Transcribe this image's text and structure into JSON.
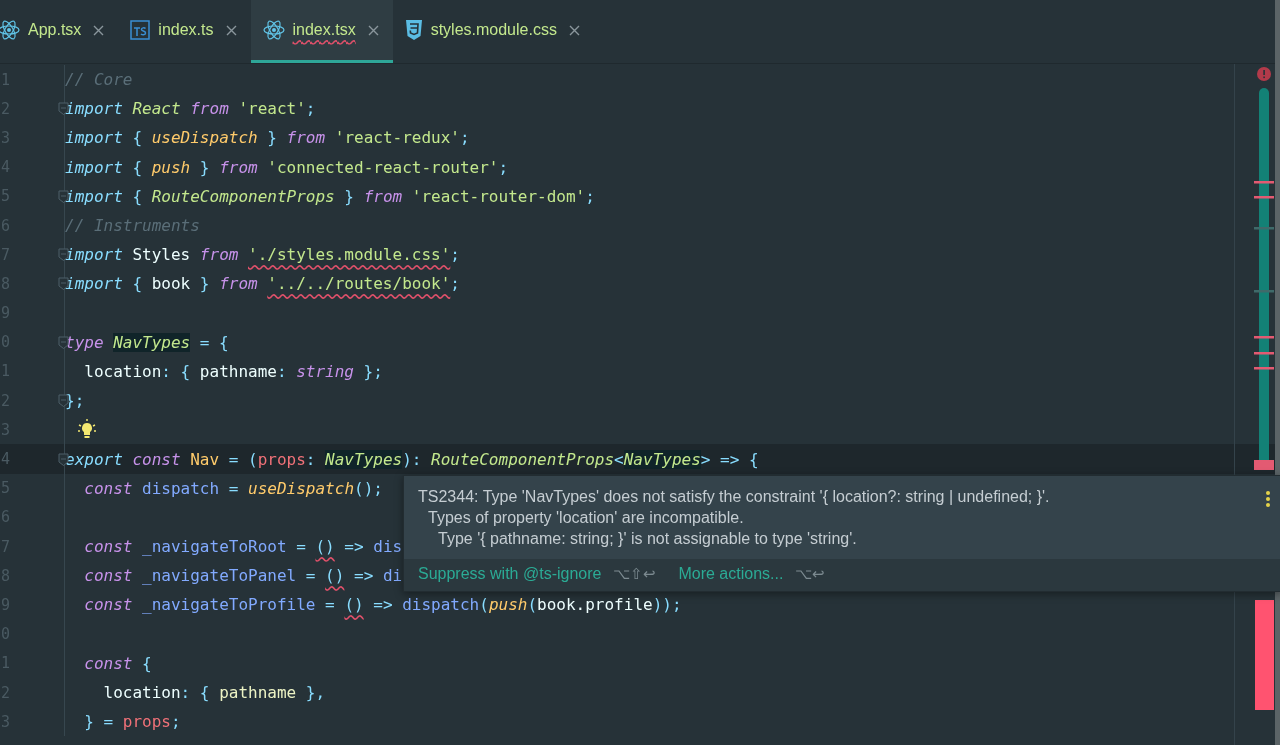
{
  "tabs": [
    {
      "label": "App.tsx",
      "kind": "react",
      "selected": false,
      "error": false
    },
    {
      "label": "index.ts",
      "kind": "ts",
      "selected": false,
      "error": false
    },
    {
      "label": "index.tsx",
      "kind": "react",
      "selected": true,
      "error": true
    },
    {
      "label": "styles.module.css",
      "kind": "css",
      "selected": false,
      "error": false
    }
  ],
  "editor": {
    "lines": [
      {
        "number": "1",
        "kind": "plain",
        "current": false,
        "tokens": [
          {
            "kind": "comment",
            "text": "// Core"
          }
        ]
      },
      {
        "number": "2",
        "kind": "fold",
        "current": false,
        "tokens": [
          {
            "kind": "imp",
            "text": "import"
          },
          {
            "kind": "type",
            "text": " React"
          },
          {
            "kind": "kw",
            "text": " from"
          },
          {
            "kind": "str",
            "text": " 'react'"
          },
          {
            "kind": "punct",
            "text": ";"
          }
        ]
      },
      {
        "number": "3",
        "kind": "plain",
        "current": false,
        "tokens": [
          {
            "kind": "imp",
            "text": "import"
          },
          {
            "kind": "punct",
            "text": " { "
          },
          {
            "kind": "fn",
            "text": "useDispatch"
          },
          {
            "kind": "punct",
            "text": " } "
          },
          {
            "kind": "kw",
            "text": "from"
          },
          {
            "kind": "str",
            "text": " 'react-redux'"
          },
          {
            "kind": "punct",
            "text": ";"
          }
        ]
      },
      {
        "number": "4",
        "kind": "plain",
        "current": false,
        "tokens": [
          {
            "kind": "imp",
            "text": "import"
          },
          {
            "kind": "punct",
            "text": " { "
          },
          {
            "kind": "fn",
            "text": "push"
          },
          {
            "kind": "punct",
            "text": " } "
          },
          {
            "kind": "kw",
            "text": "from"
          },
          {
            "kind": "str",
            "text": " 'connected-react-router'"
          },
          {
            "kind": "punct",
            "text": ";"
          }
        ]
      },
      {
        "number": "5",
        "kind": "fold",
        "current": false,
        "tokens": [
          {
            "kind": "imp",
            "text": "import"
          },
          {
            "kind": "punct",
            "text": " { "
          },
          {
            "kind": "type",
            "text": "RouteComponentProps"
          },
          {
            "kind": "punct",
            "text": " } "
          },
          {
            "kind": "kw",
            "text": "from"
          },
          {
            "kind": "str",
            "text": " 'react-router-dom'"
          },
          {
            "kind": "punct",
            "text": ";"
          }
        ]
      },
      {
        "number": "6",
        "kind": "plain",
        "current": false,
        "tokens": [
          {
            "kind": "comment",
            "text": "// Instruments"
          }
        ]
      },
      {
        "number": "7",
        "kind": "fold",
        "current": false,
        "tokens": [
          {
            "kind": "imp",
            "text": "import"
          },
          {
            "kind": "plain",
            "text": " Styles"
          },
          {
            "kind": "kw",
            "text": " from"
          },
          {
            "kind": "str-err",
            "text": "'./styles.module.css'",
            "gap": true
          },
          {
            "kind": "punct",
            "text": ";"
          }
        ]
      },
      {
        "number": "8",
        "kind": "fold",
        "current": false,
        "tokens": [
          {
            "kind": "imp",
            "text": "import"
          },
          {
            "kind": "punct",
            "text": " { "
          },
          {
            "kind": "plain",
            "text": "book"
          },
          {
            "kind": "punct",
            "text": " } "
          },
          {
            "kind": "kw",
            "text": "from"
          },
          {
            "kind": "str-err",
            "text": "'../../routes/book'",
            "gap": true
          },
          {
            "kind": "punct",
            "text": ";"
          }
        ]
      },
      {
        "number": "9",
        "kind": "plain",
        "current": false
      },
      {
        "number": "0",
        "kind": "fold",
        "current": false,
        "tokens": [
          {
            "kind": "kw",
            "text": "type"
          },
          {
            "kind": "type-hl",
            "text": "NavTypes",
            "gap": true
          },
          {
            "kind": "punct",
            "text": " = {"
          }
        ]
      },
      {
        "number": "1",
        "kind": "plain",
        "current": false,
        "tokens": [
          {
            "kind": "plain",
            "text": "  location"
          },
          {
            "kind": "punct",
            "text": ": { "
          },
          {
            "kind": "plain",
            "text": "pathname"
          },
          {
            "kind": "punct",
            "text": ": "
          },
          {
            "kind": "kw",
            "text": "string"
          },
          {
            "kind": "punct",
            "text": " };"
          }
        ]
      },
      {
        "number": "2",
        "kind": "fold",
        "current": false,
        "tokens": [
          {
            "kind": "punct",
            "text": "};"
          }
        ]
      },
      {
        "number": "3",
        "kind": "bulb",
        "current": false
      },
      {
        "number": "4",
        "kind": "fold",
        "current": true,
        "tokens": [
          {
            "kind": "imp",
            "text": "export"
          },
          {
            "kind": "kw",
            "text": " const"
          },
          {
            "kind": "name",
            "text": " Nav"
          },
          {
            "kind": "punct",
            "text": " = ("
          },
          {
            "kind": "param",
            "text": "props"
          },
          {
            "kind": "punct",
            "text": ": "
          },
          {
            "kind": "type-hl",
            "text": "NavTypes"
          },
          {
            "kind": "punct",
            "text": "): "
          },
          {
            "kind": "type",
            "text": "RouteComponentProps"
          },
          {
            "kind": "punct",
            "text": "<"
          },
          {
            "kind": "type-hl",
            "text": "NavTypes"
          },
          {
            "kind": "punct",
            "text": "> => {"
          }
        ]
      },
      {
        "number": "5",
        "kind": "plain",
        "current": false,
        "tokens": [
          {
            "kind": "kw",
            "text": "  const"
          },
          {
            "kind": "var",
            "text": " dispatch"
          },
          {
            "kind": "punct",
            "text": " = "
          },
          {
            "kind": "fn",
            "text": "useDispatch"
          },
          {
            "kind": "punct",
            "text": "();"
          }
        ]
      },
      {
        "number": "6",
        "kind": "plain",
        "current": false
      },
      {
        "number": "7",
        "kind": "plain",
        "current": false,
        "tokens": [
          {
            "kind": "kw",
            "text": "  const"
          },
          {
            "kind": "var",
            "text": " _navigateToRoot"
          },
          {
            "kind": "punct",
            "text": " = "
          },
          {
            "kind": "punct-err",
            "text": "()"
          },
          {
            "kind": "punct",
            "text": " => "
          },
          {
            "kind": "var",
            "text": "dis"
          }
        ]
      },
      {
        "number": "8",
        "kind": "plain",
        "current": false,
        "tokens": [
          {
            "kind": "kw",
            "text": "  const"
          },
          {
            "kind": "var",
            "text": " _navigateToPanel"
          },
          {
            "kind": "punct",
            "text": " = "
          },
          {
            "kind": "punct-err",
            "text": "()"
          },
          {
            "kind": "punct",
            "text": " => "
          },
          {
            "kind": "var",
            "text": "di"
          }
        ]
      },
      {
        "number": "9",
        "kind": "plain",
        "current": false,
        "tokens": [
          {
            "kind": "kw",
            "text": "  const"
          },
          {
            "kind": "var",
            "text": " _navigateToProfile"
          },
          {
            "kind": "punct",
            "text": " = "
          },
          {
            "kind": "punct-err",
            "text": "()"
          },
          {
            "kind": "punct",
            "text": " => "
          },
          {
            "kind": "var",
            "text": "dispatch"
          },
          {
            "kind": "punct",
            "text": "("
          },
          {
            "kind": "fn",
            "text": "push"
          },
          {
            "kind": "punct",
            "text": "("
          },
          {
            "kind": "plain",
            "text": "book.profile"
          },
          {
            "kind": "punct",
            "text": "));"
          }
        ]
      },
      {
        "number": "0",
        "kind": "plain",
        "current": false
      },
      {
        "number": "1",
        "kind": "plain",
        "current": false,
        "tokens": [
          {
            "kind": "kw",
            "text": "  const"
          },
          {
            "kind": "punct",
            "text": " {"
          }
        ]
      },
      {
        "number": "2",
        "kind": "plain",
        "current": false,
        "tokens": [
          {
            "kind": "plain",
            "text": "    location"
          },
          {
            "kind": "punct",
            "text": ": { "
          },
          {
            "kind": "prop",
            "text": "pathname"
          },
          {
            "kind": "punct",
            "text": " },"
          }
        ]
      },
      {
        "number": "3",
        "kind": "plain",
        "current": false,
        "tokens": [
          {
            "kind": "punct",
            "text": "  } = "
          },
          {
            "kind": "param",
            "text": "props"
          },
          {
            "kind": "punct",
            "text": ";"
          }
        ]
      }
    ]
  },
  "popup": {
    "message": [
      "TS2344: Type 'NavTypes' does not satisfy the constraint '{ location?: string | undefined; }'.",
      "Types of property 'location' are incompatible.",
      "Type '{ pathname: string; }' is not assignable to type 'string'."
    ],
    "actions": [
      {
        "label": "Suppress with @ts-ignore",
        "shortcut": "⌥⇧↩"
      },
      {
        "label": "More actions...",
        "shortcut": "⌥↩"
      }
    ]
  }
}
